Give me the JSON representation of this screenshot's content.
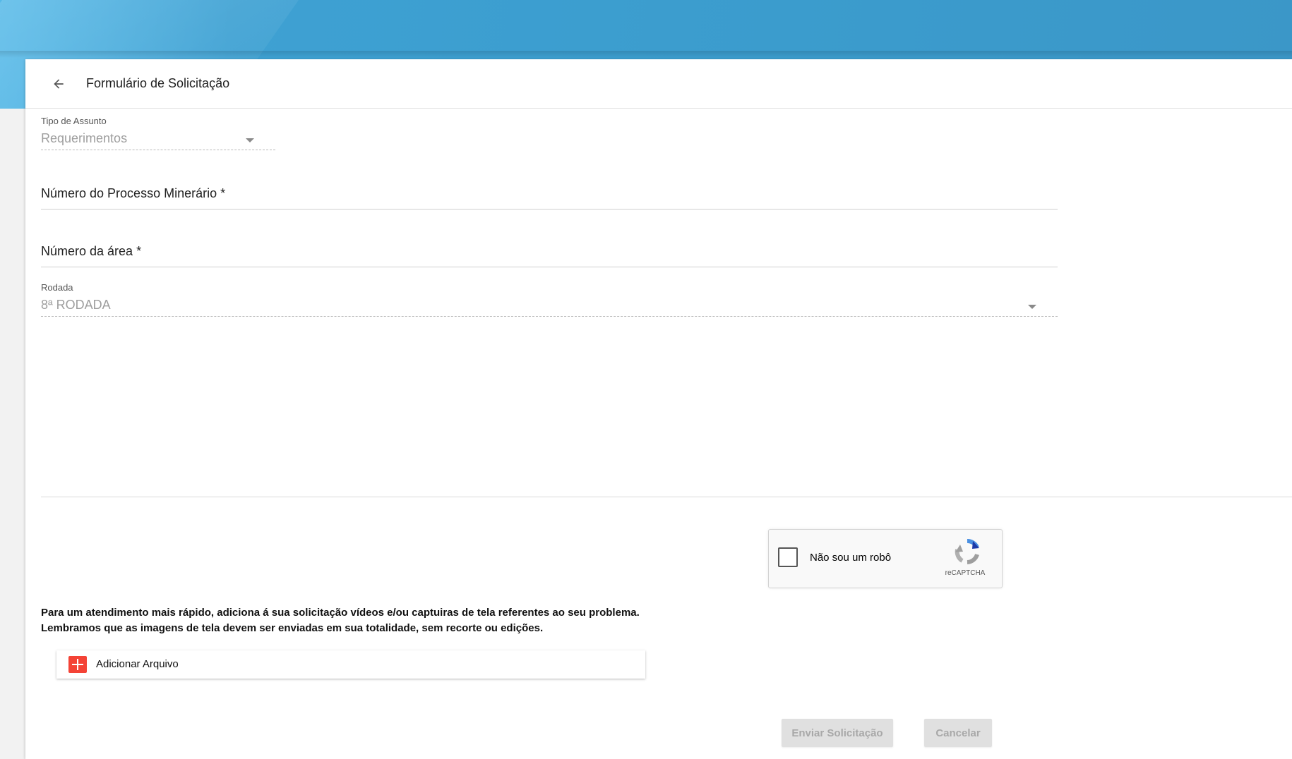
{
  "header": {
    "title": "Formulário de Solicitação"
  },
  "form": {
    "subject_type": {
      "label": "Tipo de Assunto",
      "value": "Requerimentos"
    },
    "process_number": {
      "label": "Número do Processo Minerário *"
    },
    "area_number": {
      "label": "Número da área *"
    },
    "round": {
      "label": "Rodada",
      "value": "8ª RODADA"
    }
  },
  "captcha": {
    "label": "Não sou um robô",
    "brand": "reCAPTCHA"
  },
  "attachments": {
    "info_line1": "Para um atendimento mais rápido, adiciona á sua solicitação vídeos e/ou captuiras de tela referentes ao seu problema.",
    "info_line2": "Lembramos que as imagens de tela devem ser enviadas em sua totalidade, sem recorte ou edições.",
    "add_label": "Adicionar Arquivo"
  },
  "actions": {
    "submit_label": "Enviar Solicitação",
    "cancel_label": "Cancelar"
  },
  "colors": {
    "banner": "#3b9ccd",
    "add_icon": "#f44336",
    "disabled_button": "#e0e0e0"
  },
  "icons": {
    "back": "arrow-left-icon",
    "dropdown": "caret-down-icon",
    "add": "plus-icon",
    "captcha": "recaptcha-logo-icon"
  }
}
